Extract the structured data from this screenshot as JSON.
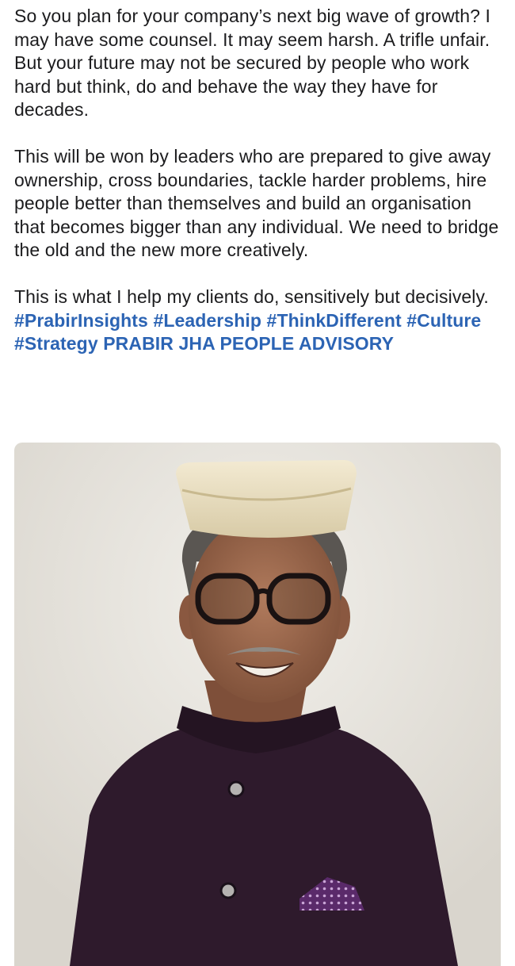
{
  "post": {
    "paragraphs": [
      "So you plan for your company’s next big wave of growth? I may have some counsel. It may seem harsh. A trifle unfair. But your future may not be secured by people who work hard but think, do and behave the way they have for decades.",
      "This will be won by leaders who are prepared to give away ownership, cross boundaries, tackle harder problems, hire people better than themselves and build an organisation that becomes bigger than any individual. We need to bridge the old and the new more creatively."
    ],
    "closing_text": "This is what I help my clients do, sensitively but decisively. ",
    "hashtags": [
      "#PrabirInsights",
      "#Leadership",
      "#ThinkDifferent",
      "#Culture",
      "#Strategy"
    ],
    "mention": "PRABIR JHA PEOPLE ADVISORY"
  },
  "photo": {
    "subject": "Portrait of a smiling man with glasses, cream cap and dark purple bandhgala jacket with pocket square"
  },
  "colors": {
    "text": "#1c1c1e",
    "link": "#2c64b4",
    "photo_background": "#e9e6df",
    "jacket": "#2e1a2c"
  }
}
